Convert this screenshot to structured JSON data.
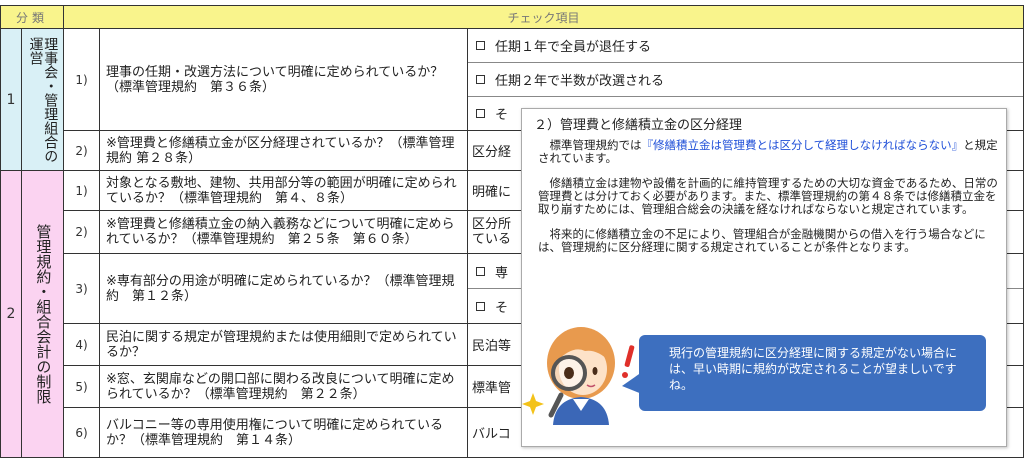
{
  "header": {
    "category": "分類",
    "checklist": "チェック項目"
  },
  "sections": [
    {
      "number": "1",
      "title": "理事会・管理組合の運営"
    },
    {
      "number": "2",
      "title": "管理規約・組合会計の制限"
    }
  ],
  "rows": [
    {
      "num": "1)",
      "question": "理事の任期・改選方法について明確に定められているか？（標準管理規約　第３６条）"
    },
    {
      "num": "2)",
      "question": "※管理費と修繕積立金が区分経理されているか？（標準管理規約 第２８条）"
    },
    {
      "num": "1)",
      "question": "対象となる敷地、建物、共用部分等の範囲が明確に定められているか？（標準管理規約　第４、８条）"
    },
    {
      "num": "2)",
      "question": "※管理費と修繕積立金の納入義務などについて明確に定められているか？（標準管理規約　第２５条　第６０条）"
    },
    {
      "num": "3)",
      "question": "※専有部分の用途が明確に定められているか？（標準管理規約　第１２条）"
    },
    {
      "num": "4)",
      "question": "民泊に関する規定が管理規約または使用細則で定められているか？"
    },
    {
      "num": "5)",
      "question": "※窓、玄関扉などの開口部に関わる改良について明確に定められているか？（標準管理規約　第２２条）"
    },
    {
      "num": "6)",
      "question": "バルコニー等の専用使用権について明確に定められているか？（標準管理規約　第１４条）"
    }
  ],
  "answers": {
    "r1a": "任期１年で全員が退任する",
    "r1b": "任期２年で半数が改選される",
    "r1c": "そ",
    "r2": "区分経",
    "r3": "明確に",
    "r4a": "区分所",
    "r4b": "ている",
    "r5a": "専",
    "r5b": "そ",
    "r6": "民泊等",
    "r7": "標準管",
    "r8": "バルコ"
  },
  "popup": {
    "title": "２）管理費と修繕積立金の区分経理",
    "p1_pre": "標準管理規約では",
    "p1_highlight": "『修繕積立金は管理費とは区分して経理しなければならない』",
    "p1_post": "と規定されています。",
    "p2": "修繕積立金は建物や設備を計画的に維持管理するための大切な資金であるため、日常の管理費とは分けておく必要があります。また、標準管理規約の第４８条では修繕積立金を取り崩すためには、管理組合総会の決議を経なければならないと規定されています。",
    "p3": "将来的に修繕積立金の不足により、管理組合が金融機関からの借入を行う場合などには、管理規約に区分経理に関する規定されていることが条件となります。",
    "bubble": "現行の管理規約に区分経理に関する規定がない場合には、早い時期に規約が改定されることが望ましいですね。"
  },
  "colors": {
    "header_bg": "#f9f48c",
    "section1_bg": "#d9f0f6",
    "section2_bg": "#fbd3f1",
    "bubble_bg": "#3d6fbf",
    "highlight": "#1f4fd8"
  },
  "icons": [
    "checkbox-icon",
    "magnifier-girl-illustration",
    "exclamation-icon",
    "sparkle-icon"
  ]
}
